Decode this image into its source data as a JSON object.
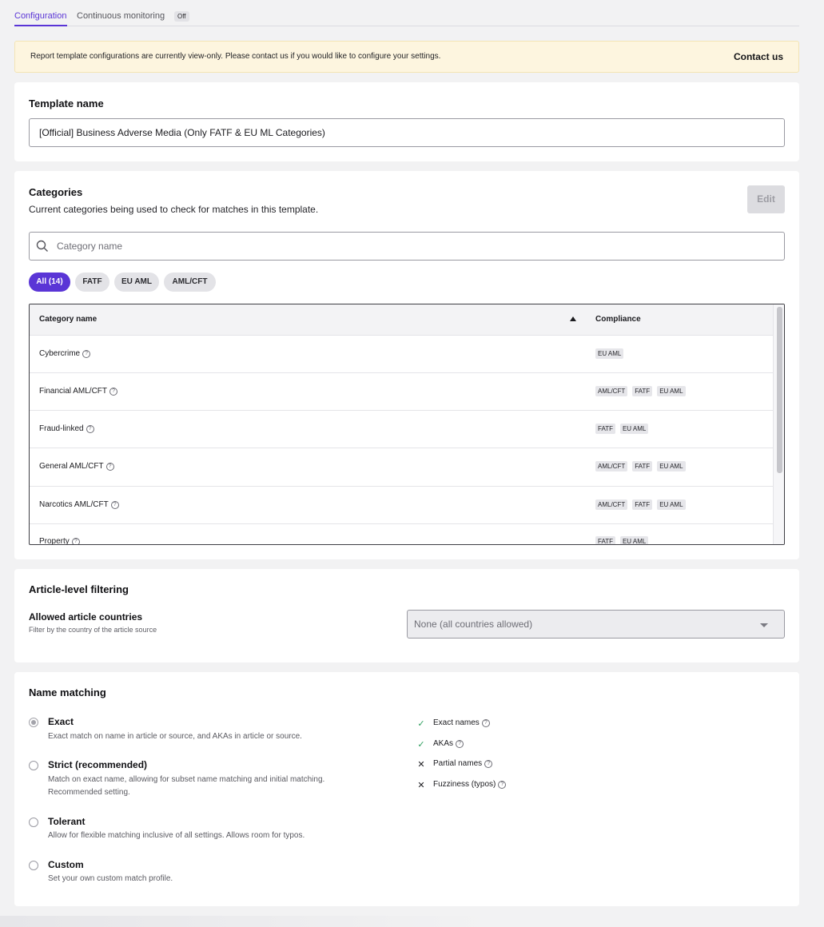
{
  "tabs": {
    "configuration": "Configuration",
    "monitoring": "Continuous monitoring",
    "monitoring_badge": "Off"
  },
  "alert": {
    "message": "Report template configurations are currently view-only. Please contact us if you would like to configure your settings.",
    "link": "Contact us"
  },
  "template": {
    "title": "Template name",
    "value": "[Official] Business Adverse Media (Only FATF & EU ML Categories)"
  },
  "categories": {
    "title": "Categories",
    "subtitle": "Current categories being used to check for matches in this template.",
    "edit_label": "Edit",
    "search_placeholder": "Category name",
    "chips": [
      "All (14)",
      "FATF",
      "EU AML",
      "AML/CFT"
    ],
    "columns": {
      "name": "Category name",
      "compliance": "Compliance"
    },
    "rows": [
      {
        "name": "Cybercrime",
        "tags": [
          "EU AML"
        ]
      },
      {
        "name": "Financial AML/CFT",
        "tags": [
          "AML/CFT",
          "FATF",
          "EU AML"
        ]
      },
      {
        "name": "Fraud-linked",
        "tags": [
          "FATF",
          "EU AML"
        ]
      },
      {
        "name": "General AML/CFT",
        "tags": [
          "AML/CFT",
          "FATF",
          "EU AML"
        ]
      },
      {
        "name": "Narcotics AML/CFT",
        "tags": [
          "AML/CFT",
          "FATF",
          "EU AML"
        ]
      },
      {
        "name": "Property",
        "tags": [
          "FATF",
          "EU AML"
        ]
      }
    ]
  },
  "article": {
    "title": "Article-level filtering",
    "field_label": "Allowed article countries",
    "field_help": "Filter by the country of the article source",
    "select_value": "None (all countries allowed)"
  },
  "matching": {
    "title": "Name matching",
    "options": [
      {
        "label": "Exact",
        "desc": "Exact match on name in article or source, and AKAs in article or source.",
        "selected": true
      },
      {
        "label": "Strict (recommended)",
        "desc": "Match on exact name, allowing for subset name matching and initial matching.",
        "desc2": "Recommended setting.",
        "selected": false
      },
      {
        "label": "Tolerant",
        "desc": "Allow for flexible matching inclusive of all settings. Allows room for typos.",
        "selected": false
      },
      {
        "label": "Custom",
        "desc": "Set your own custom match profile.",
        "selected": false
      }
    ],
    "features": [
      {
        "label": "Exact names",
        "enabled": true
      },
      {
        "label": "AKAs",
        "enabled": true
      },
      {
        "label": "Partial names",
        "enabled": false
      },
      {
        "label": "Fuzziness (typos)",
        "enabled": false
      }
    ]
  },
  "colors": {
    "accent": "#5a35d6",
    "alert_bg": "#fdf5df",
    "check": "#2e9e5e"
  }
}
